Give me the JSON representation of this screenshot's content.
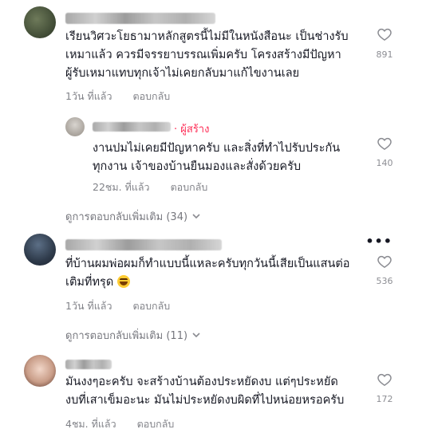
{
  "comments": [
    {
      "text_lines": [
        "เรียนวิศวะโยธามาหลักสูตรนี้ไม่มีในหนังสือนะ เป็นช่างรับ",
        "เหมาแล้ว ควรมีจรรยาบรรณเพิ่มครับ โครงสร้างมีปัญหา",
        "ผู้รับเหมาแทบทุกเจ้าไม่เคยกลับมาแก้ไขงานเลย"
      ],
      "time": "1วัน ที่แล้ว",
      "reply_label": "ตอบกลับ",
      "likes": "891"
    },
    {
      "author_badge": "· ผู้สร้าง",
      "text_lines": [
        "งานปมไม่เคยมีปัญหาครับ และสิ่งที่ทำไปรับประกัน",
        "ทุกงาน เจ้าของบ้านยืนมองและสั่งด้วยครับ"
      ],
      "time": "22ชม. ที่แล้ว",
      "reply_label": "ตอบกลับ",
      "likes": "140"
    },
    {
      "text_lines": [
        "ที่บ้านผมพ่อผมก็ทำแบบนี้แหละครับทุกวันนี้เสียเป็นแสนต่อ",
        "เติมที่ทรุด"
      ],
      "emoji": "grinning-face-emoji",
      "time": "1วัน ที่แล้ว",
      "reply_label": "ตอบกลับ",
      "likes": "536",
      "more": "•••"
    },
    {
      "text_lines": [
        "มันงงๆอะครับ จะสร้างบ้านต้องประหยัดงบ แต่ๆประหยัด",
        "งบที่เสาเข็มอะนะ มันไม่ประหยัดงบผิดที่ไปหน่อยหรอครับ"
      ],
      "time": "4ชม. ที่แล้ว",
      "reply_label": "ตอบกลับ",
      "likes": "172"
    }
  ],
  "view_more": [
    "ดูการตอบกลับเพิ่มเติม (34)",
    "ดูการตอบกลับเพิ่มเติม (11)"
  ],
  "colors": {
    "accent": "#fe2c55",
    "text": "#161823",
    "muted": "#8a8b91"
  }
}
